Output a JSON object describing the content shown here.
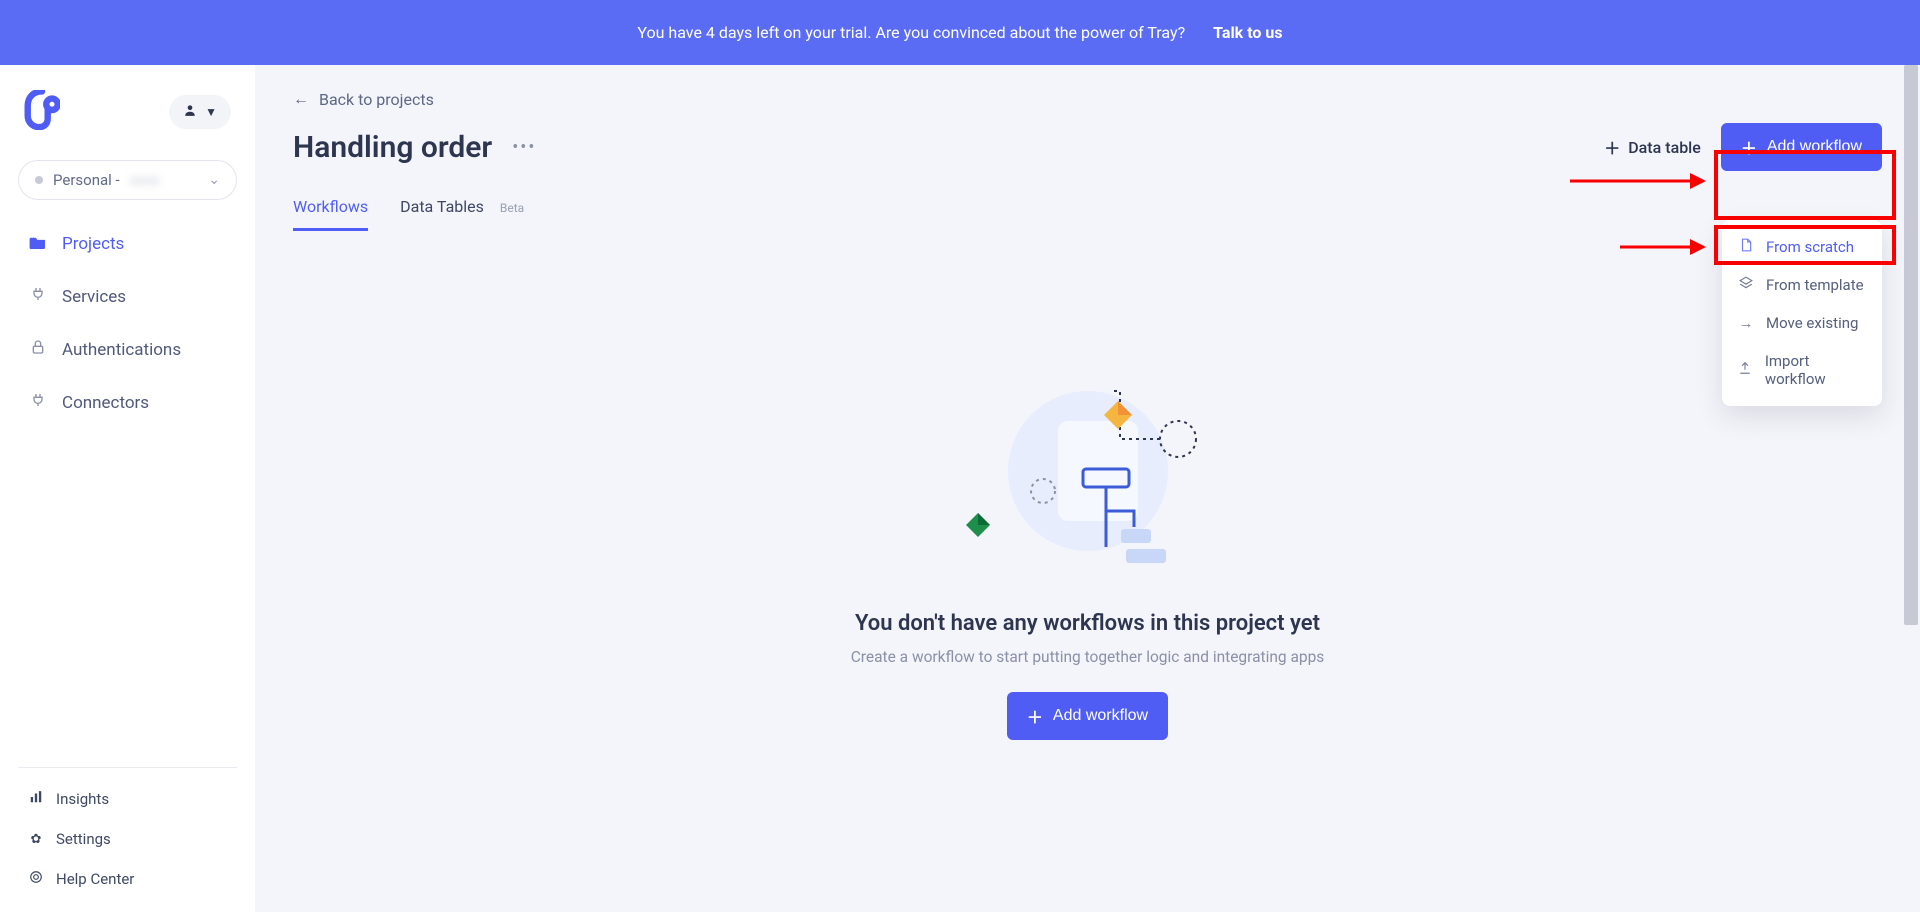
{
  "banner": {
    "message": "You have 4 days left on your trial. Are you convinced about the power of Tray?",
    "cta": "Talk to us"
  },
  "workspace": {
    "label_prefix": "Personal -",
    "label_hidden": "xxxx"
  },
  "sidebar": {
    "nav": [
      {
        "icon": "folder",
        "label": "Projects",
        "active": true
      },
      {
        "icon": "plug",
        "label": "Services"
      },
      {
        "icon": "lock",
        "label": "Authentications"
      },
      {
        "icon": "plug",
        "label": "Connectors"
      }
    ],
    "footer": [
      {
        "icon": "bar-chart",
        "label": "Insights"
      },
      {
        "icon": "gear",
        "label": "Settings"
      },
      {
        "icon": "life-ring",
        "label": "Help Center"
      }
    ]
  },
  "header": {
    "back_label": "Back to projects",
    "title": "Handling order",
    "data_table": "Data table",
    "add_workflow": "Add workflow"
  },
  "tabs": [
    {
      "label": "Workflows",
      "active": true
    },
    {
      "label": "Data Tables",
      "badge": "Beta"
    }
  ],
  "dropdown": [
    {
      "icon": "file",
      "label": "From scratch",
      "selected": true
    },
    {
      "icon": "layers",
      "label": "From template"
    },
    {
      "icon": "arrow-r",
      "label": "Move existing"
    },
    {
      "icon": "upload",
      "label": "Import workflow"
    }
  ],
  "empty": {
    "title": "You don't have any workflows in this project yet",
    "subtitle": "Create a workflow to start putting together logic and integrating apps",
    "button": "Add workflow"
  }
}
